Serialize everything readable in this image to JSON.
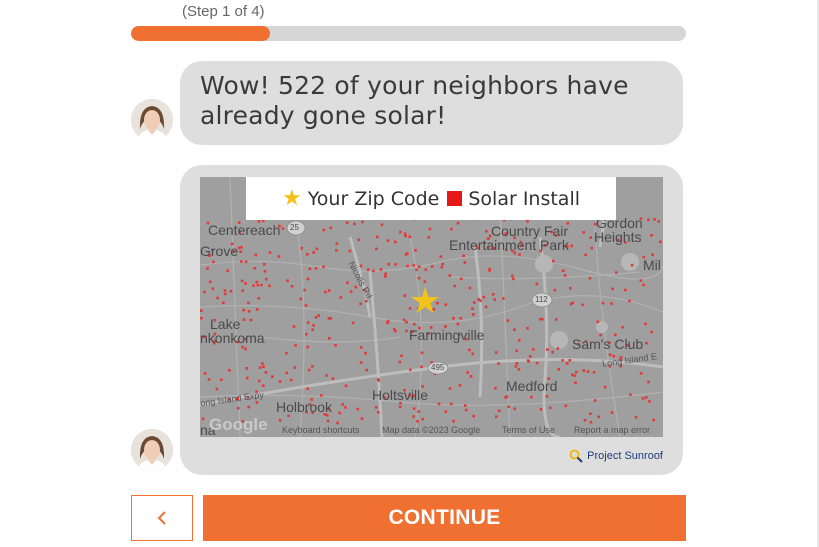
{
  "progress": {
    "step_label": "(Step 1 of 4)",
    "fraction": 0.25,
    "color": "#ef7030"
  },
  "chat": {
    "agent_avatar": "woman-portrait",
    "message": "Wow! 522 of your neighbors have already gone solar!",
    "map_card": {
      "legend": {
        "zip_icon": "star-icon",
        "zip_label": "Your Zip Code",
        "install_icon": "red-square-icon",
        "install_label": "Solar Install"
      },
      "place_labels": {
        "centereach": "Centereach",
        "grove": "Grove",
        "country_fair": "Country Fair",
        "entertainment_park": "Entertainment Park",
        "gordon": "Gordon",
        "heights": "Heights",
        "mil": "Mil",
        "lake": "Lake",
        "ronkonkoma": "nkonkoma",
        "farmingville": "Farmingville",
        "sams_club": "Sam's Club",
        "long_island_expy_right": "Long Island E",
        "medford": "Medford",
        "holtsville": "Holtsville",
        "holbrook": "Holbrook",
        "long_island_expy_left": "ong Island Expy",
        "na": "na",
        "nicolls_rd": "Nicolls Rd"
      },
      "road_shields": [
        "25",
        "112",
        "495"
      ],
      "attribution": {
        "logo": "Google",
        "shortcuts": "Keyboard shortcuts",
        "map_data": "Map data ©2023 Google",
        "terms": "Terms of Use",
        "report": "Report a map error"
      },
      "branding": "Project Sunroof"
    }
  },
  "nav": {
    "back_icon": "chevron-left-icon",
    "continue_label": "CONTINUE"
  }
}
